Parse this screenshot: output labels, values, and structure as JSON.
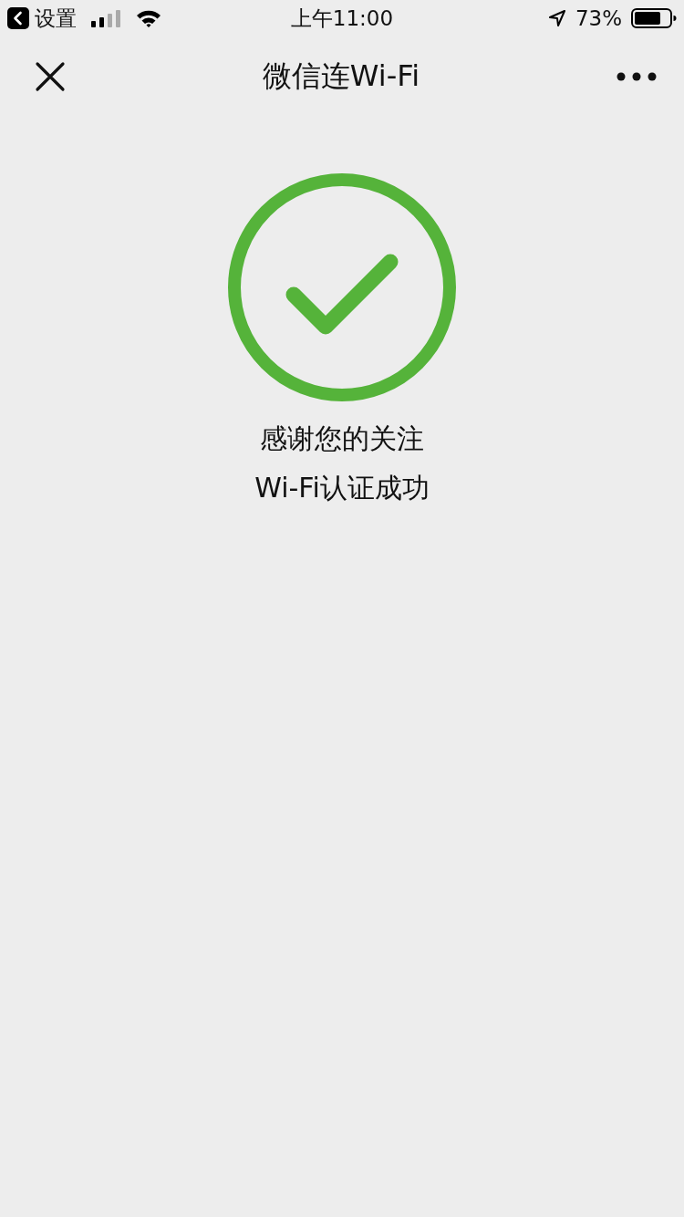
{
  "status_bar": {
    "back_app": "设置",
    "time": "上午11:00",
    "battery": "73%"
  },
  "nav_bar": {
    "title": "微信连Wi-Fi"
  },
  "result": {
    "kind": "success",
    "lines": [
      "感谢您的关注",
      "Wi-Fi认证成功"
    ]
  }
}
